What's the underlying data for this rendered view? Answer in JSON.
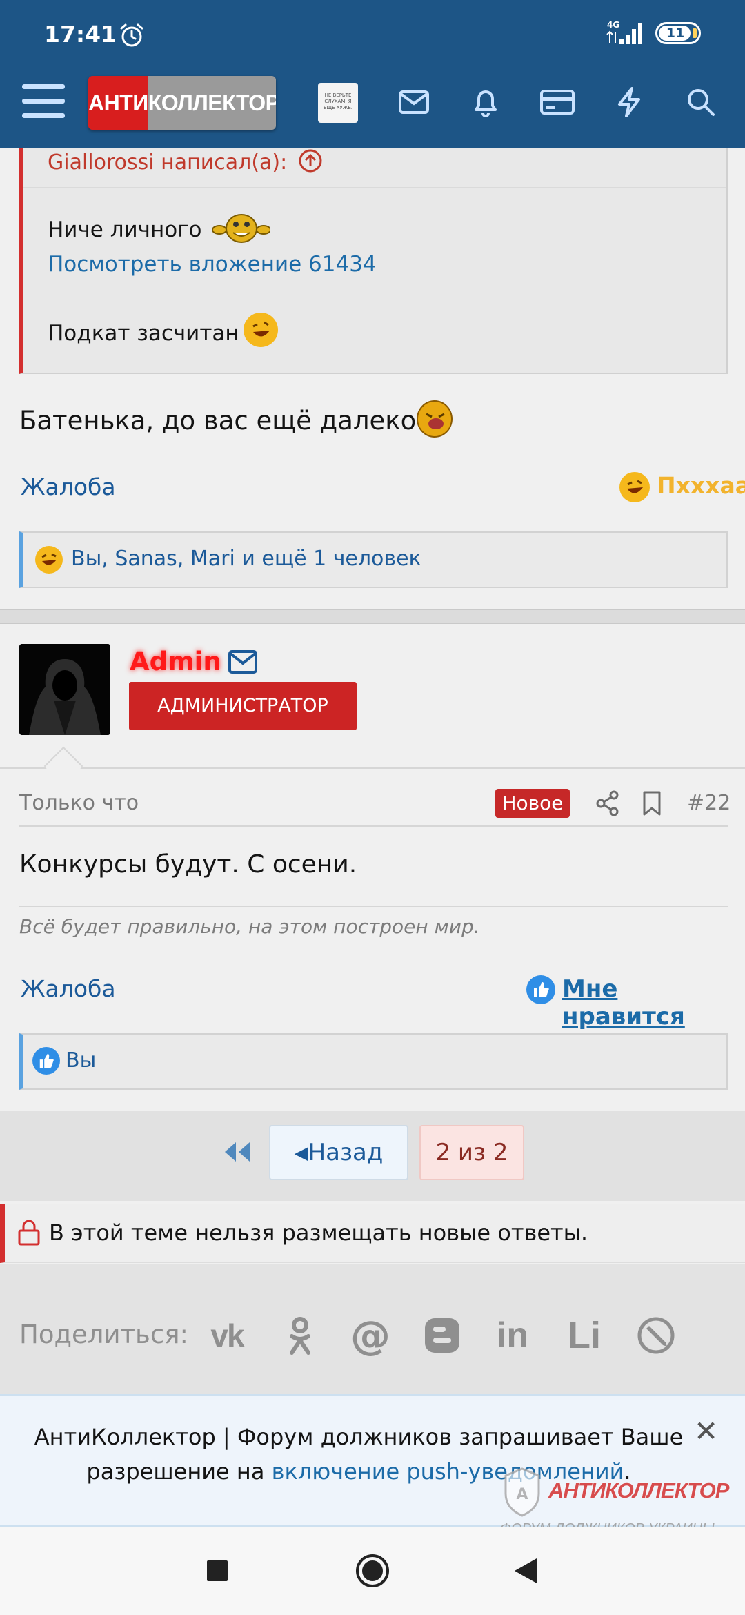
{
  "status_bar": {
    "time": "17:41",
    "network": "4G",
    "battery": "11"
  },
  "header": {
    "logo_text": "АНТИКОЛЛЕКТОР",
    "banner_text": "НЕ ВЕРЬТЕ СЛУХАМ, Я ЕЩЕ ХУЖЕ.",
    "icons": [
      "menu-icon",
      "mail-icon",
      "bell-icon",
      "card-icon",
      "bolt-icon",
      "search-icon"
    ],
    "colors": {
      "bar": "#1d5586",
      "logo_red": "#d81e1e"
    }
  },
  "post1": {
    "quote_author": "Giallorossi написал(а):",
    "quote_lines": [
      "Ниче личного",
      "Посмотреть вложение 61434",
      "Подкат засчитан"
    ],
    "body": "Батенька, до вас ещё далеко",
    "report": "Жалоба",
    "reaction_label": "Пхххаа",
    "reactions_summary": "Вы, Sanas, Mari и ещё 1 человек"
  },
  "post2": {
    "username": "Admin",
    "role_badge": "АДМИНИСТРАТОР",
    "time": "Только что",
    "new_badge": "Новое",
    "post_number": "#22",
    "body": "Конкурсы будут. С осени.",
    "signature": "Всё будет правильно, на этом построен мир.",
    "report": "Жалоба",
    "like": "Мне нравится",
    "reactions_summary": "Вы"
  },
  "pagination": {
    "back": "Назад",
    "current": "2 из 2"
  },
  "locked_notice": "В этой теме нельзя размещать новые ответы.",
  "share": {
    "label": "Поделиться:",
    "services": [
      "vk-icon",
      "odnoklassniki-icon",
      "mailru-icon",
      "blogger-icon",
      "linkedin-icon",
      "liveinternet-icon",
      "livejournal-icon"
    ]
  },
  "push_notice": {
    "text_before": "АнтиКоллектор | Форум должников запрашивает Ваше разрешение на ",
    "link": "включение push-уведомлений",
    "text_after": ".",
    "close": "✕"
  },
  "watermark": {
    "brand": "АНТИКОЛЛЕКТОР",
    "sub": "ФОРУМ ДОЛЖНИКОВ УКРАИНЫ"
  }
}
